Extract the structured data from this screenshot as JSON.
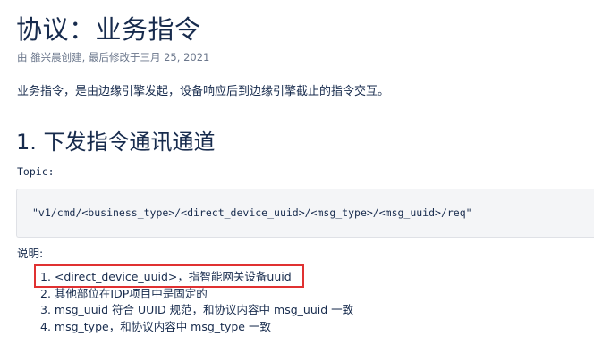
{
  "page": {
    "title": "协议：业务指令",
    "byline": "由 雒兴晨创建, 最后修改于三月 25, 2021",
    "intro": "业务指令，是由边缘引擎发起，设备响应后到边缘引擎截止的指令交互。"
  },
  "section": {
    "heading": "1. 下发指令通讯通道",
    "topic_label": "Topic:",
    "topic_value": "\"v1/cmd/<business_type>/<direct_device_uuid>/<msg_type>/<msg_uuid>/req\"",
    "note_label": "说明:",
    "items": [
      "1. <direct_device_uuid>，指智能网关设备uuid",
      "2. 其他部位在IDP项目中是固定的",
      "3. msg_uuid 符合 UUID 规范，和协议内容中 msg_uuid 一致",
      "4. msg_type，和协议内容中 msg_type 一致"
    ]
  },
  "colors": {
    "text": "#172b4d",
    "meta": "#6b778c",
    "code_bg": "#f4f5f7",
    "highlight": "#e03131"
  }
}
